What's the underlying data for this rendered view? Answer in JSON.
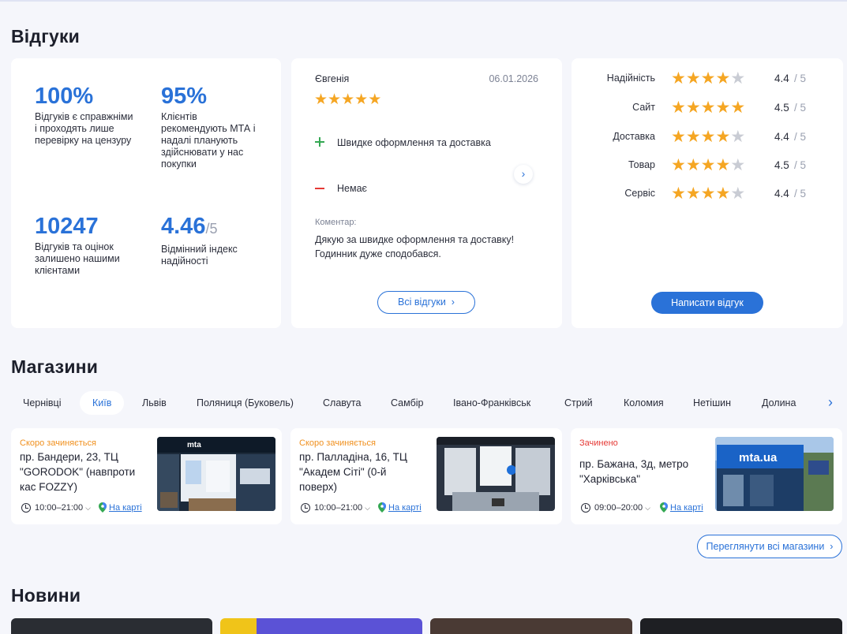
{
  "reviews": {
    "title": "Відгуки",
    "stats": [
      {
        "value": "100%",
        "denominator": "",
        "desc": "Відгуків є справжніми і проходять лише перевірку на цензуру"
      },
      {
        "value": "95%",
        "denominator": "",
        "desc": "Клієнтів рекомендують МТА і надалі планують здійснювати у нас покупки"
      },
      {
        "value": "10247",
        "denominator": "",
        "desc": "Відгуків та оцінок залишено нашими клієнтами"
      },
      {
        "value": "4.46",
        "denominator": "/5",
        "desc": "Відмінний індекс надійності"
      }
    ],
    "review": {
      "author": "Євгенія",
      "date": "06.01.2026",
      "stars": 5,
      "pros_text": "Швидке оформлення та доставка",
      "cons_text": "Немає",
      "comment_label": "Коментар:",
      "comment_text": "Дякую за швидке оформлення та доставку! Годинник дуже сподобався.",
      "all_reviews_button": "Всі відгуки",
      "next_icon": "chevron-right-icon"
    },
    "ratings": [
      {
        "label": "Надійність",
        "value": "4.4",
        "den": "/ 5",
        "filled": 4
      },
      {
        "label": "Сайт",
        "value": "4.5",
        "den": "/ 5",
        "filled": 5
      },
      {
        "label": "Доставка",
        "value": "4.4",
        "den": "/ 5",
        "filled": 4
      },
      {
        "label": "Товар",
        "value": "4.5",
        "den": "/ 5",
        "filled": 4
      },
      {
        "label": "Сервіс",
        "value": "4.4",
        "den": "/ 5",
        "filled": 4
      }
    ],
    "write_review_button": "Написати відгук"
  },
  "stores": {
    "title": "Магазини",
    "cities": [
      "Чернівці",
      "Київ",
      "Львів",
      "Поляниця (Буковель)",
      "Славута",
      "Самбір",
      "Івано-Франківськ",
      "Стрий",
      "Коломия",
      "Нетішин",
      "Долина"
    ],
    "active_city": "Київ",
    "items": [
      {
        "status": "Скоро зачиняється",
        "status_color": "#f0901e",
        "address": "пр. Бандери, 23, ТЦ \"GORODOK\" (навпроти кас FOZZY)",
        "hours": "10:00–21:00",
        "map_link": "На карті"
      },
      {
        "status": "Скоро зачиняється",
        "status_color": "#f0901e",
        "address": "пр. Палладіна, 16, ТЦ \"Академ Сіті\" (0-й поверх)",
        "hours": "10:00–21:00",
        "map_link": "На карті"
      },
      {
        "status": "Зачинено",
        "status_color": "#e53935",
        "address": "пр. Бажана, 3д, метро \"Харківська\"",
        "hours": "09:00–20:00",
        "map_link": "На карті"
      }
    ],
    "all_stores_button": "Переглянути всі магазини"
  },
  "news": {
    "title": "Новини"
  },
  "colors": {
    "accent": "#2a72d8",
    "star": "#f5a623",
    "plus": "#34a853",
    "minus": "#e53935"
  }
}
